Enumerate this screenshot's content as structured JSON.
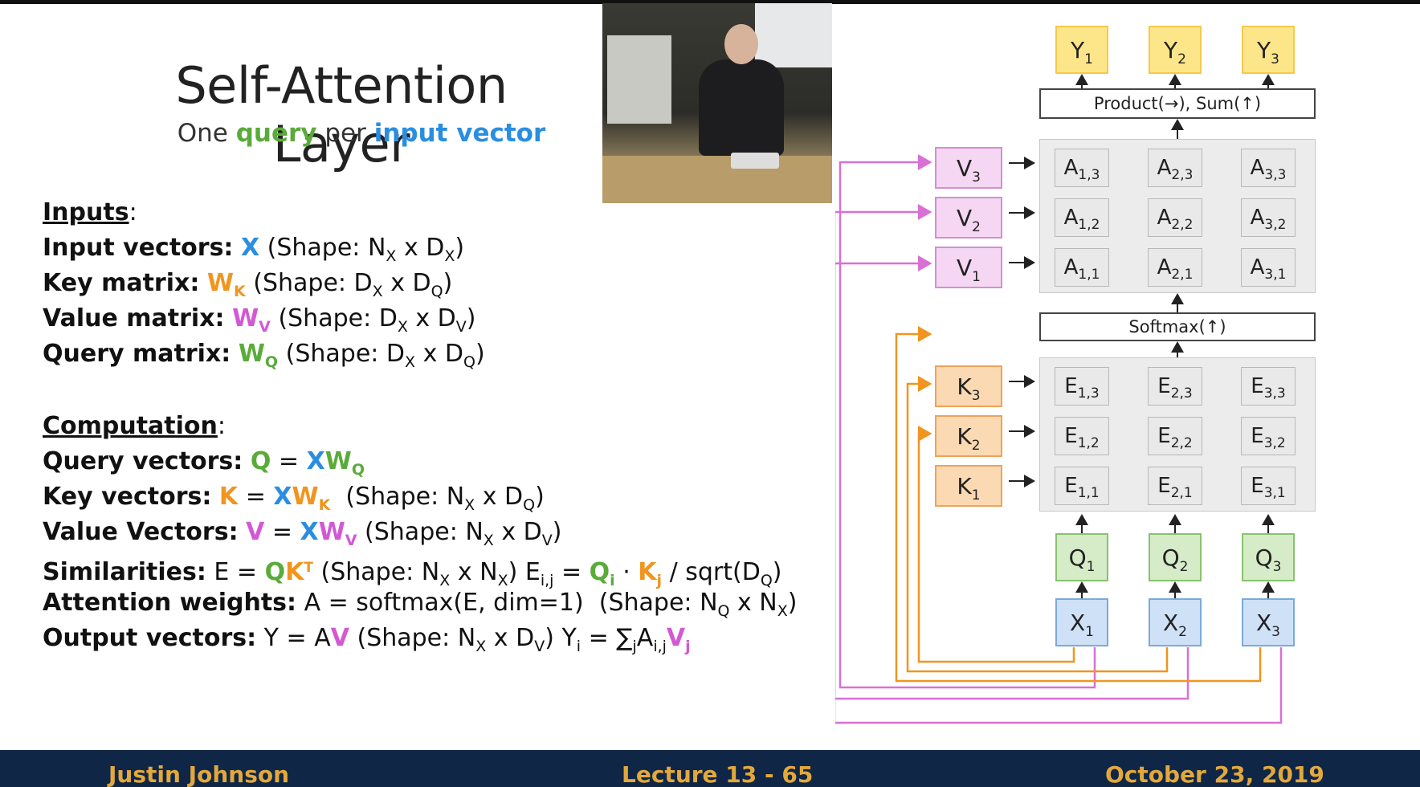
{
  "slide": {
    "title": "Self-Attention Layer",
    "subtitle": {
      "pre": "One",
      "word1": "query",
      "mid": "per",
      "word2": "input vector"
    }
  },
  "inputs": {
    "heading": "Inputs",
    "lines": [
      {
        "label": "Input vectors:",
        "sym": "X",
        "shape_pre": "(Shape: N",
        "s1": "X",
        "shape_mid": " x D",
        "s2": "X",
        "shape_end": ")"
      },
      {
        "label": "Key matrix:",
        "sym": "W",
        "symsub": "K",
        "shape_pre": "(Shape: D",
        "s1": "X",
        "shape_mid": " x D",
        "s2": "Q",
        "shape_end": ")"
      },
      {
        "label": "Value matrix:",
        "sym": "W",
        "symsub": "V",
        "shape_pre": "(Shape: D",
        "s1": "X",
        "shape_mid": " x D",
        "s2": "V",
        "shape_end": ")"
      },
      {
        "label": "Query matrix:",
        "sym": "W",
        "symsub": "Q",
        "shape_pre": "(Shape: D",
        "s1": "X",
        "shape_mid": " x D",
        "s2": "Q",
        "shape_end": ")"
      }
    ]
  },
  "computation": {
    "heading": "Computation",
    "query": {
      "label": "Query vectors:",
      "lhs": "Q",
      "eq": " = ",
      "x": "X",
      "w": "W",
      "wsub": "Q"
    },
    "key": {
      "label": "Key vectors:",
      "lhs": "K",
      "eq": " = ",
      "x": "X",
      "w": "W",
      "wsub": "K",
      "shape": "(Shape: N",
      "s1": "X",
      "mid": " x D",
      "s2": "Q",
      "end": ")"
    },
    "value": {
      "label": "Value Vectors:",
      "lhs": "V",
      "eq": " = ",
      "x": "X",
      "w": "W",
      "wsub": "V",
      "shape": "(Shape: N",
      "s1": "X",
      "mid": " x D",
      "s2": "V",
      "end": ")"
    },
    "sim": {
      "label": "Similarities:",
      "pre": "E = ",
      "q": "Q",
      "k": "K",
      "t": "T",
      "shape": "(Shape: N",
      "s1": "X",
      "mid": " x N",
      "s2": "X",
      "end": ")",
      "e": "E",
      "esub": "i,j",
      "eq": " = ",
      "qi": "Q",
      "qisub": "i",
      "dot": " · ",
      "kj": "K",
      "kjsub": "j",
      "div": " / sqrt(D",
      "dsub": "Q",
      "close": ")"
    },
    "attn": {
      "label": "Attention weights:",
      "body": "A = softmax(E, dim=1)",
      "shape": "(Shape: N",
      "s1": "Q",
      "mid": " x N",
      "s2": "X",
      "end": ")"
    },
    "out": {
      "label": "Output vectors:",
      "pre": "Y = A",
      "v": "V",
      "shape": "(Shape: N",
      "s1": "X",
      "mid": " x D",
      "s2": "V",
      "end": ")",
      "y": "Y",
      "ysub": "i",
      "eq": " = ∑",
      "jsub": "j",
      "a": "A",
      "asub": "i,j",
      "vj": "V",
      "vjsub": "j"
    }
  },
  "diagram": {
    "y_nodes": [
      {
        "b": "Y",
        "s": "1"
      },
      {
        "b": "Y",
        "s": "2"
      },
      {
        "b": "Y",
        "s": "3"
      }
    ],
    "product_op": "Product(→),  Sum(↑)",
    "softmax_op": "Softmax(↑)",
    "v_nodes": [
      {
        "b": "V",
        "s": "3"
      },
      {
        "b": "V",
        "s": "2"
      },
      {
        "b": "V",
        "s": "1"
      }
    ],
    "k_nodes": [
      {
        "b": "K",
        "s": "3"
      },
      {
        "b": "K",
        "s": "2"
      },
      {
        "b": "K",
        "s": "1"
      }
    ],
    "a_cells": [
      [
        {
          "b": "A",
          "s": "1,3"
        },
        {
          "b": "A",
          "s": "2,3"
        },
        {
          "b": "A",
          "s": "3,3"
        }
      ],
      [
        {
          "b": "A",
          "s": "1,2"
        },
        {
          "b": "A",
          "s": "2,2"
        },
        {
          "b": "A",
          "s": "3,2"
        }
      ],
      [
        {
          "b": "A",
          "s": "1,1"
        },
        {
          "b": "A",
          "s": "2,1"
        },
        {
          "b": "A",
          "s": "3,1"
        }
      ]
    ],
    "e_cells": [
      [
        {
          "b": "E",
          "s": "1,3"
        },
        {
          "b": "E",
          "s": "2,3"
        },
        {
          "b": "E",
          "s": "3,3"
        }
      ],
      [
        {
          "b": "E",
          "s": "1,2"
        },
        {
          "b": "E",
          "s": "2,2"
        },
        {
          "b": "E",
          "s": "3,2"
        }
      ],
      [
        {
          "b": "E",
          "s": "1,1"
        },
        {
          "b": "E",
          "s": "2,1"
        },
        {
          "b": "E",
          "s": "3,1"
        }
      ]
    ],
    "q_nodes": [
      {
        "b": "Q",
        "s": "1"
      },
      {
        "b": "Q",
        "s": "2"
      },
      {
        "b": "Q",
        "s": "3"
      }
    ],
    "x_nodes": [
      {
        "b": "X",
        "s": "1"
      },
      {
        "b": "X",
        "s": "2"
      },
      {
        "b": "X",
        "s": "3"
      }
    ],
    "colors": {
      "value_line": "#d870d6",
      "key_line": "#f0951f",
      "arrow": "#222222"
    }
  },
  "footer": {
    "author": "Justin Johnson",
    "lecture": "Lecture 13 - 65",
    "date": "October 23, 2019"
  }
}
